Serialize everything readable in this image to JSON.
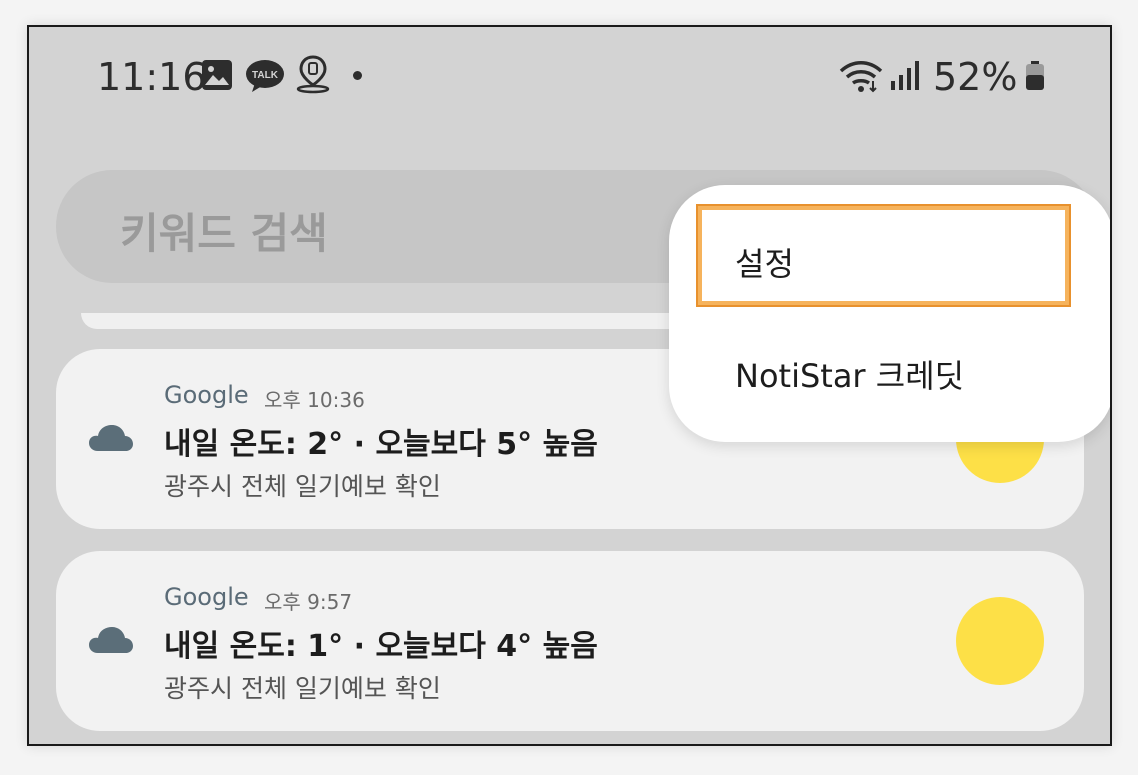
{
  "status_bar": {
    "time": "11:16",
    "talk_label": "TALK",
    "battery": "52%",
    "icons": [
      "gallery-icon",
      "kakaotalk-icon",
      "location-pin-icon",
      "dot-icon",
      "wifi-icon",
      "signal-icon",
      "battery-icon"
    ]
  },
  "search": {
    "placeholder": "키워드 검색"
  },
  "menu": {
    "items": [
      {
        "label": "설정",
        "highlighted": true
      },
      {
        "label": "NotiStar 크레딧",
        "highlighted": false
      }
    ]
  },
  "notifications": [
    {
      "app": "Google",
      "time": "오후 10:36",
      "title": "내일 온도: 2° · 오늘보다 5° 높음",
      "subtitle": "광주시 전체 일기예보 확인",
      "icon": "cloud-icon"
    },
    {
      "app": "Google",
      "time": "오후 9:57",
      "title": "내일 온도: 1° · 오늘보다 4° 높음",
      "subtitle": "광주시 전체 일기예보 확인",
      "icon": "cloud-icon"
    }
  ],
  "colors": {
    "background": "#d3d3d3",
    "card": "#f2f2f2",
    "sun": "#fde047",
    "highlight": "#f6b35c",
    "cloud": "#5b6e79"
  }
}
